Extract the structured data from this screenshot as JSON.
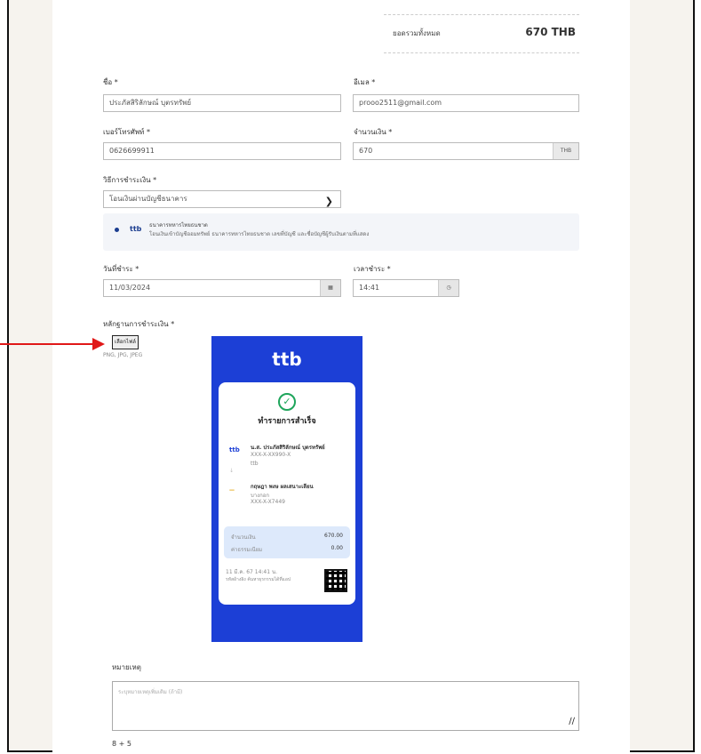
{
  "summary": {
    "label": "ยอดรวมทั้งหมด",
    "value": "670 THB"
  },
  "form": {
    "name_label": "ชื่อ *",
    "name_value": "ประภัสสิริลักษณ์ บุตรทรัพย์",
    "email_label": "อีเมล *",
    "email_value": "prooo2511@gmail.com",
    "phone_label": "เบอร์โทรศัพท์ *",
    "phone_value": "0626699911",
    "amount_label": "จำนวนเงิน *",
    "amount_value": "670",
    "amount_unit": "THB",
    "method_label": "วิธีการชำระเงิน *",
    "method_value": "โอนเงินผ่านบัญชีธนาคาร",
    "bank_note": {
      "bank": "ttb",
      "title": "ธนาคารทหารไทยธนชาต",
      "text": "โอนเงินเข้าบัญชีออมทรัพย์ ธนาคารทหารไทยธนชาต เลขที่บัญชี และชื่อบัญชีผู้รับเงินตามที่แสดง"
    },
    "date_label": "วันที่ชำระ *",
    "date_value": "11/03/2024",
    "time_label": "เวลาชำระ *",
    "time_value": "14:41",
    "proof_label": "หลักฐานการชำระเงิน *",
    "upload_button": "เลือกไฟล์",
    "upload_hint": "PNG, JPG, JPEG",
    "notes_label": "หมายเหตุ",
    "notes_placeholder": "ระบุหมายเหตุเพิ่มเติม (ถ้ามี)",
    "captcha": "8 + 5"
  },
  "receipt": {
    "logo": "ttb",
    "status": "ทำรายการสำเร็จ",
    "from_bank": "ttb",
    "from_name": "น.ส. ประภัสสิริลักษณ์ บุตรทรัพย์",
    "from_acct": "XXX-X-XX990-X",
    "from_sub": "ttb",
    "to_name": "กฤษฎา พงษ ผลเสนาะเลียน",
    "to_bank": "บางกอก",
    "to_acct": "XXX-X-X7449",
    "amount_label": "จำนวนเงิน",
    "amount_value": "670.00",
    "fee_label": "ค่าธรรมเนียม",
    "fee_value": "0.00",
    "datetime": "11 มี.ค. 67 14:41 น.",
    "ref": "รหัสอ้างอิง ค้นหาธุรกรรมได้ที่แอป"
  },
  "colors": {
    "receipt_bg": "#1c3fd6",
    "arrow": "#e01818",
    "success": "#1ea55b"
  }
}
